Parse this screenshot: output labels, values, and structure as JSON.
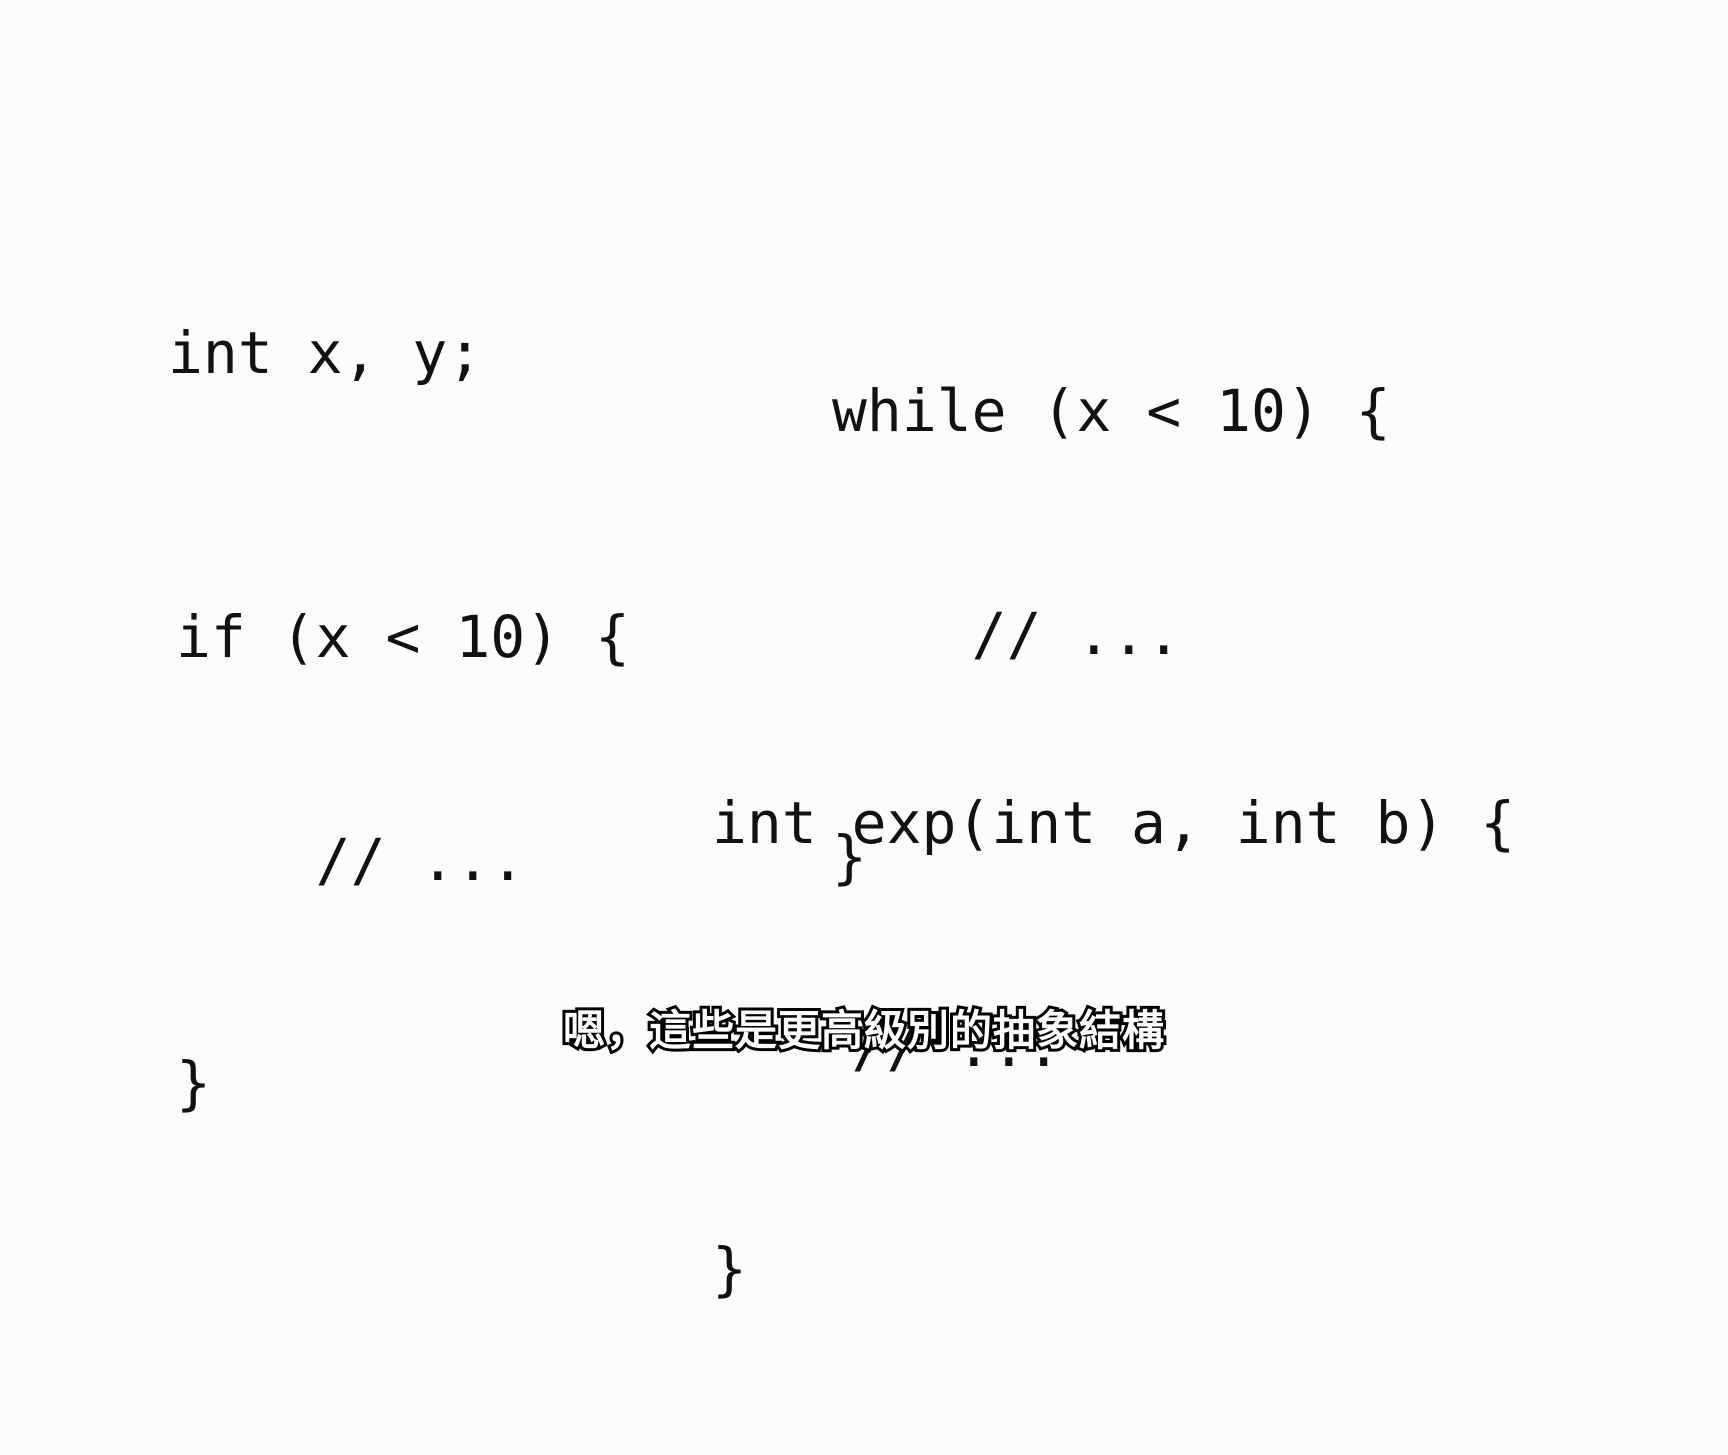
{
  "canvas": {
    "background_color": "#fcfcfc",
    "text_color": "#111111"
  },
  "code_blocks": [
    {
      "id": "declaration",
      "name": "variable-declaration",
      "lines": [
        "int x, y;"
      ]
    },
    {
      "id": "while",
      "name": "while-loop",
      "lines": [
        "while (x < 10) {",
        "    // ...",
        "}"
      ]
    },
    {
      "id": "if",
      "name": "if-statement",
      "lines": [
        "if (x < 10) {",
        "    // ...",
        "}"
      ]
    },
    {
      "id": "function",
      "name": "function-definition",
      "lines": [
        "int exp(int a, int b) {",
        "    // ...",
        "}"
      ]
    }
  ],
  "snippets": {
    "declaration": {
      "line1": "int x, y;"
    },
    "while_loop": {
      "line1": "while (x < 10) {",
      "line2": "    // ...",
      "line3": "}"
    },
    "if_statement": {
      "line1": "if (x < 10) {",
      "line2": "    // ...",
      "line3": "}"
    },
    "function_def": {
      "line1": "int exp(int a, int b) {",
      "line2": "    // ...",
      "line3": "}"
    }
  },
  "subtitle": {
    "text": "嗯，這些是更高級別的抽象結構",
    "fill_color": "#ffffff",
    "outline_color": "#000000"
  }
}
